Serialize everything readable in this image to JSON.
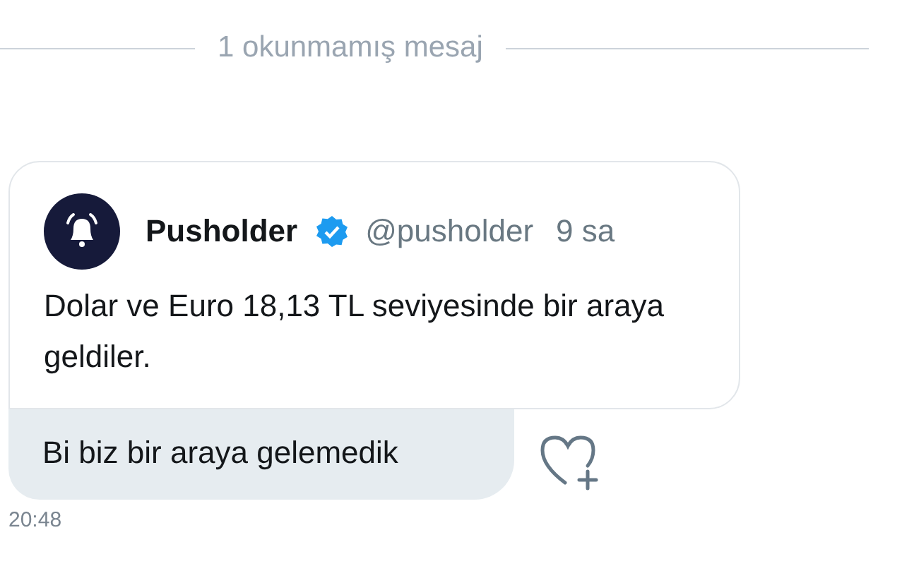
{
  "divider": {
    "text": "1 okunmamış mesaj"
  },
  "quoted_tweet": {
    "name": "Pusholder",
    "verified": true,
    "handle": "@pusholder",
    "time": "9 sa",
    "text": "Dolar ve Euro 18,13 TL seviyesinde bir araya geldiler."
  },
  "message": {
    "text": "Bi biz bir araya gelemedik",
    "time": "20:48"
  }
}
